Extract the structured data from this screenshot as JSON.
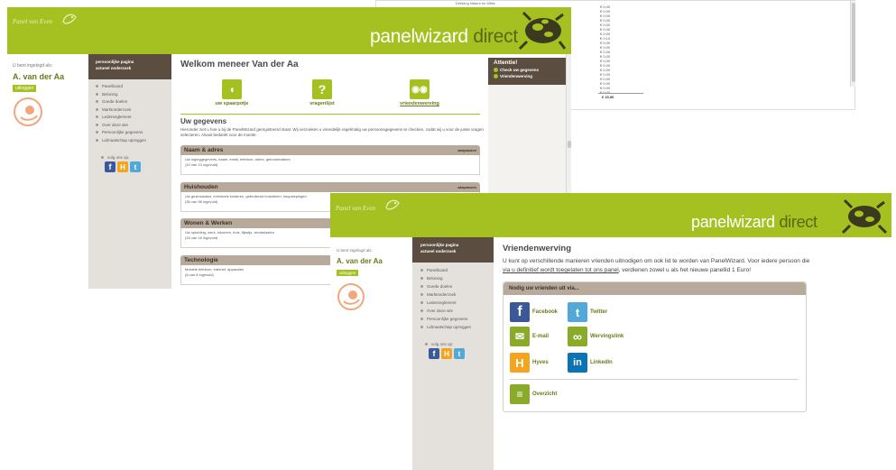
{
  "brand": {
    "small": "Panel van Even",
    "big_main": "panelwizard",
    "big_sub": "direct"
  },
  "colors": {
    "accent_green": "#a4c121",
    "sidebar_brown": "#5b4d3f",
    "panel_tan": "#b7aa9b"
  },
  "icons": {
    "spaarpotje": "piggy-bank-icon",
    "vragenlijst": "question-icon",
    "vriendenwerving": "people-icon",
    "facebook": "facebook-icon",
    "twitter": "twitter-icon",
    "email": "email-icon",
    "wervingslink": "link-icon",
    "hyves": "hyves-icon",
    "linkedin": "linkedin-icon",
    "overzicht": "list-icon"
  },
  "user": {
    "login_label": "U bent ingelogd als:",
    "name": "A. van der Aa",
    "logout": "uitloggen"
  },
  "sidebar": {
    "head": [
      "persoonlijke pagina",
      "actueel onderzoek"
    ],
    "items": [
      "Panelboard",
      "Beloning",
      "Goede doelen",
      "Marktonderzoek",
      "Ledenreglement",
      "Over deze site",
      "Persoonlijke gegevens",
      "Lidmaatschap opzeggen"
    ],
    "follow": "volg ons op:"
  },
  "window1": {
    "welcome": "Welkom meneer Van der Aa",
    "tiles": [
      "uw spaarpotje",
      "vragenlijst",
      "vriendenwerving"
    ],
    "section_title": "Uw gegevens",
    "section_intro": "Hieronder ziet u hoe u bij de PanelWizard geregistreerd staat. Wij verzoeken u vriendelijk regelmatig uw persoonsgegevens te checken, zodat wij u voor de juiste vragen selecteren. Alvast bedankt voor de moeite.",
    "panels": [
      {
        "title": "Naam & adres",
        "action": "aanpassen",
        "line1": "Uw loginggegevens, naam, email, telefoon, adres, geboortedatum",
        "line2": "(10 van 13 ingevuld)"
      },
      {
        "title": "Huishouden",
        "action": "aanpassen",
        "line1": "Uw gezinsstatus, eventuele kinderen, gebruikend huisdieren, koopslepingen",
        "line2": "(36 van 58 ingevuld)"
      },
      {
        "title": "Wonen & Werken",
        "action": "",
        "line1": "Uw opleiding, werk, inkomen, huis, fijkwijs, zienbelasten",
        "line2": "(16 van 18 ingevuld)"
      },
      {
        "title": "Technologie",
        "action": "",
        "line1": "Mobiele telefoon, internet, apparaten",
        "line2": "(8 van 8 ingevuld)"
      }
    ],
    "attention": {
      "title": "Attentie!",
      "items": [
        "Check uw gegevens",
        "Vriendenwerving"
      ]
    }
  },
  "window2": {
    "header_text": "Drinking Nature en Miles",
    "values": [
      "€ 0,00",
      "€ 0,00",
      "€ 0,00",
      "€ 0,00",
      "€ 0,00",
      "€ 0,00",
      "€ 0,00",
      "€ 0,10",
      "€ 0,00",
      "€ 0,00",
      "€ 2,00",
      "€ 0,00",
      "€ 0,00",
      "€ 0,00",
      "€ 0,00",
      "€ 0,00",
      "€ 0,00",
      "€ 0,00",
      "€ 0,00",
      "€ 0,00"
    ],
    "total": "€ 15,96"
  },
  "window3": {
    "title": "Vriendenwerving",
    "intro_part1": "U kunt op verschillende manieren vrienden uitnodigen om ook lid te worden van PanelWizard. Voor iedere persoon die ",
    "intro_link": "via u definitief wordt toegelaten tot ons panel",
    "intro_part2": ", verdienen zowel u als het nieuwe panellid 1 Euro!",
    "box_title": "Nodig uw vrienden uit via...",
    "options": [
      {
        "label": "Facebook",
        "letter": "f"
      },
      {
        "label": "Twitter",
        "letter": "t"
      },
      {
        "label": "E-mail",
        "letter": "✉"
      },
      {
        "label": "Wervingslink",
        "letter": "∞"
      },
      {
        "label": "Hyves",
        "letter": "H"
      },
      {
        "label": "LinkedIn",
        "letter": "in"
      }
    ],
    "overview": "Overzicht"
  }
}
